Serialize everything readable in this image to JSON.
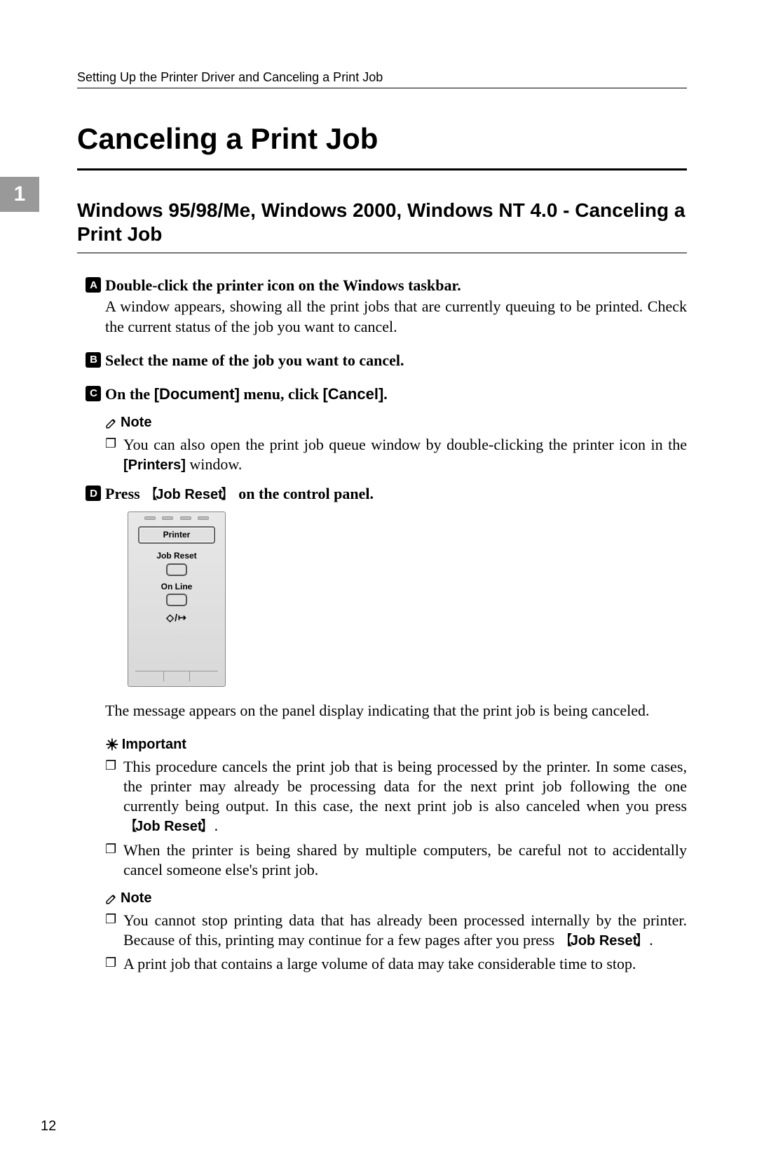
{
  "running_header": "Setting Up the Printer Driver and Canceling a Print Job",
  "chapter_tab": "1",
  "title": "Canceling a Print Job",
  "subtitle": "Windows 95/98/Me, Windows 2000, Windows NT 4.0 - Canceling a Print Job",
  "steps": {
    "s1": {
      "num": "A",
      "head": "Double-click the printer icon on the Windows taskbar.",
      "body": "A window appears, showing all the print jobs that are currently queuing to be printed. Check the current status of the job you want to cancel."
    },
    "s2": {
      "num": "B",
      "head": "Select the name of the job you want to cancel."
    },
    "s3": {
      "num": "C",
      "pre": "On the ",
      "menu1": "[Document]",
      "mid": " menu, click ",
      "menu2": "[Cancel]",
      "post": "."
    },
    "s4": {
      "num": "D",
      "pre": "Press ",
      "key": "Job Reset",
      "post": " on the control panel."
    }
  },
  "note1": {
    "label": "Note",
    "text_pre": "You can also open the print job queue window by double-clicking the printer icon in the ",
    "printers": "[Printers]",
    "text_post": " window."
  },
  "panel": {
    "printer": "Printer",
    "job_reset": "Job Reset",
    "on_line": "On Line",
    "data_icon": "◇/↦"
  },
  "after_panel": "The message appears on the panel display indicating that the print job is being canceled.",
  "important": {
    "label": "Important",
    "items": [
      {
        "pre": "This procedure cancels the print job that is being processed by the printer. In some cases, the printer may already be processing data for the next print job following the one currently being output. In this case, the next print job is also canceled when you press ",
        "key": "Job Reset",
        "post": "."
      },
      {
        "pre": "When the printer is being shared by multiple computers, be careful not to accidentally cancel someone else's print job.",
        "key": "",
        "post": ""
      }
    ]
  },
  "note2": {
    "label": "Note",
    "items": [
      {
        "pre": "You cannot stop printing data that has already been processed internally by the printer. Because of this, printing may continue for a few pages after you press ",
        "key": "Job Reset",
        "post": "."
      },
      {
        "pre": "A print job that contains a large volume of data may take considerable time to stop.",
        "key": "",
        "post": ""
      }
    ]
  },
  "page_number": "12"
}
